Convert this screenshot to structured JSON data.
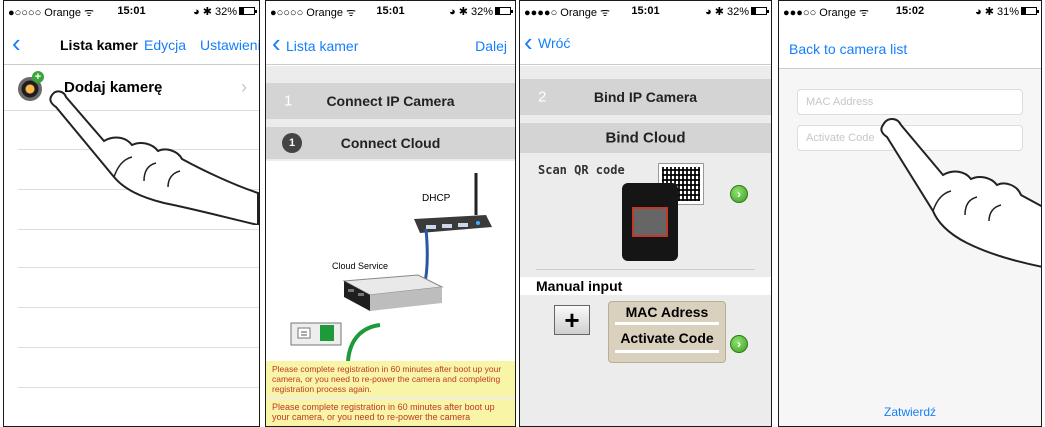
{
  "screens": [
    {
      "status": {
        "carrier": "●○○○○ Orange ᯤ",
        "time": "15:01",
        "right": "◕ ✱ 32%",
        "battery_level": 0.32
      },
      "nav": {
        "back": "‹",
        "title": "Lista kamer",
        "edit": "Edycja",
        "settings": "Ustawienia"
      },
      "row": {
        "label": "Dodaj kamerę",
        "chevron": "›"
      }
    },
    {
      "status": {
        "carrier": "●○○○○ Orange ᯤ",
        "time": "15:01",
        "right": "◕ ✱ 32%",
        "battery_level": 0.32
      },
      "nav": {
        "back": "‹",
        "back_label": "Lista kamer",
        "next": "Dalej"
      },
      "step_header": {
        "num": "1",
        "text": "Connect IP Camera"
      },
      "sub_header": {
        "num": "1",
        "text": "Connect Cloud"
      },
      "diagram": {
        "router_label": "DHCP",
        "device_label": "Cloud Service"
      },
      "warning": "Please complete registration in 60 minutes after boot up your camera, or you need to re-power the camera and completing registration process again.",
      "warning2": "Please complete registration in 60 minutes after boot up your camera, or you need to re-power the camera"
    },
    {
      "status": {
        "carrier": "●●●●○ Orange ᯤ",
        "time": "15:01",
        "right": "◕ ✱ 32%",
        "battery_level": 0.32
      },
      "nav": {
        "back": "‹",
        "back_label": "Wróć"
      },
      "step_header": {
        "num": "2",
        "text": "Bind IP Camera"
      },
      "sub_header": {
        "text": "Bind Cloud"
      },
      "scan_label": "Scan QR code",
      "manual_label": "Manual input",
      "mac_label": "MAC Adress",
      "code_label": "Activate Code",
      "plus": "+",
      "arrow": "›"
    },
    {
      "status": {
        "carrier": "●●●○○ Orange ᯤ",
        "time": "15:02",
        "right": "◕ ✱ 31%",
        "battery_level": 0.31
      },
      "nav": {
        "back_label": "Back to camera list"
      },
      "mac_placeholder": "MAC Address",
      "code_placeholder": "Activate Code",
      "confirm": "Zatwierdź"
    }
  ]
}
